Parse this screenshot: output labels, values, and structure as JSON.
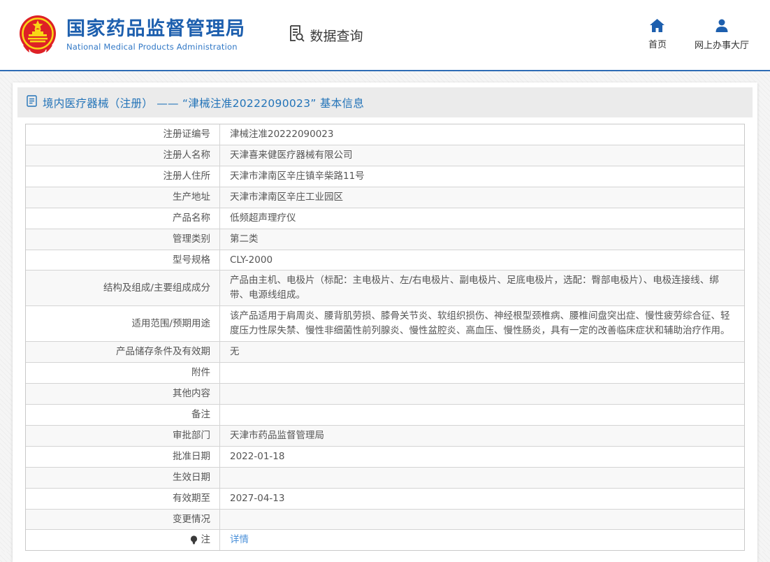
{
  "header": {
    "org_name_cn": "国家药品监督管理局",
    "org_name_en": "National Medical Products Administration",
    "data_query_label": "数据查询",
    "nav": [
      {
        "label": "首页",
        "icon": "home-icon"
      },
      {
        "label": "网上办事大厅",
        "icon": "user-icon"
      }
    ]
  },
  "banner": {
    "icon": "document-icon",
    "title": "境内医疗器械（注册） —— “津械注准20222090023” 基本信息"
  },
  "table": {
    "rows": [
      {
        "label": "注册证编号",
        "value": "津械注准20222090023"
      },
      {
        "label": "注册人名称",
        "value": "天津喜来健医疗器械有限公司"
      },
      {
        "label": "注册人住所",
        "value": "天津市津南区辛庄镇辛柴路11号"
      },
      {
        "label": "生产地址",
        "value": "天津市津南区辛庄工业园区"
      },
      {
        "label": "产品名称",
        "value": "低频超声理疗仪"
      },
      {
        "label": "管理类别",
        "value": "第二类"
      },
      {
        "label": "型号规格",
        "value": "CLY-2000"
      },
      {
        "label": "结构及组成/主要组成成分",
        "value": "产品由主机、电极片（标配：主电极片、左/右电极片、副电极片、足底电极片，选配：臀部电极片）、电极连接线、绑带、电源线组成。"
      },
      {
        "label": "适用范围/预期用途",
        "value": "该产品适用于肩周炎、腰背肌劳损、膝骨关节炎、软组织损伤、神经根型颈椎病、腰椎间盘突出症、慢性疲劳综合征、轻度压力性尿失禁、慢性非细菌性前列腺炎、慢性盆腔炎、高血压、慢性肠炎，具有一定的改善临床症状和辅助治疗作用。"
      },
      {
        "label": "产品储存条件及有效期",
        "value": "无"
      },
      {
        "label": "附件",
        "value": ""
      },
      {
        "label": "其他内容",
        "value": ""
      },
      {
        "label": "备注",
        "value": ""
      },
      {
        "label": "审批部门",
        "value": "天津市药品监督管理局"
      },
      {
        "label": "批准日期",
        "value": "2022-01-18"
      },
      {
        "label": "生效日期",
        "value": ""
      },
      {
        "label": "有效期至",
        "value": "2027-04-13"
      },
      {
        "label": "变更情况",
        "value": ""
      },
      {
        "label": "注",
        "value": "详情",
        "value_is_link": true,
        "label_icon": "note-icon"
      }
    ]
  },
  "colors": {
    "brand_blue": "#1d5fae",
    "banner_text_blue": "#2273b8",
    "link_blue": "#4a90d9",
    "divider_blue": "#2e6cb5",
    "banner_bg": "#ebebeb",
    "alt_row_bg": "#f8f8f8",
    "table_border": "#c9c9c9",
    "emblem_red": "#de2126",
    "emblem_gold": "#f9d616"
  }
}
